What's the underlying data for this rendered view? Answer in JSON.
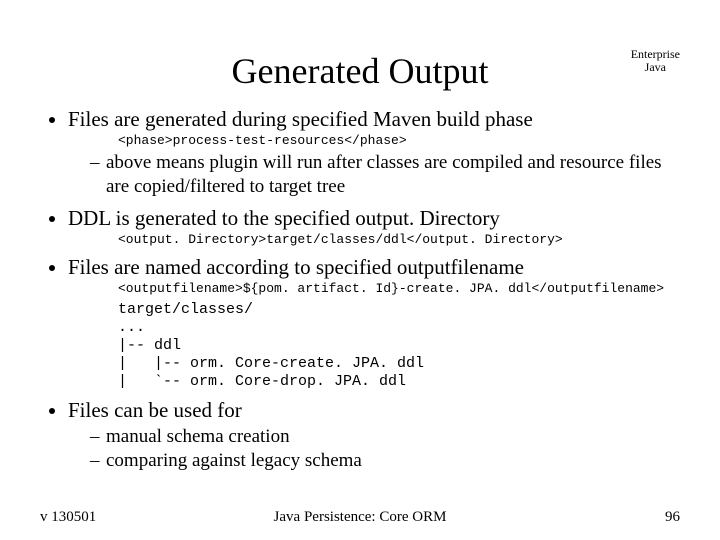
{
  "header": {
    "title": "Generated Output",
    "corner_line1": "Enterprise",
    "corner_line2": "Java"
  },
  "bullets": {
    "b1": "Files are generated during specified Maven build phase",
    "c1": "<phase>process-test-resources</phase>",
    "s1": "above means plugin will run after classes are compiled and resource files are copied/filtered to target tree",
    "b2": "DDL is generated to the specified output. Directory",
    "c2": "<output. Directory>target/classes/ddl</output. Directory>",
    "b3": "Files are named according to specified outputfilename",
    "c3": "<outputfilename>${pom. artifact. Id}-create. JPA. ddl</outputfilename>",
    "tree": "target/classes/\n...\n|-- ddl\n|   |-- orm. Core-create. JPA. ddl\n|   `-- orm. Core-drop. JPA. ddl",
    "b4": "Files can be used for",
    "s4a": "manual schema creation",
    "s4b": "comparing against legacy schema"
  },
  "footer": {
    "left": "v 130501",
    "center": "Java Persistence: Core ORM",
    "right": "96"
  }
}
